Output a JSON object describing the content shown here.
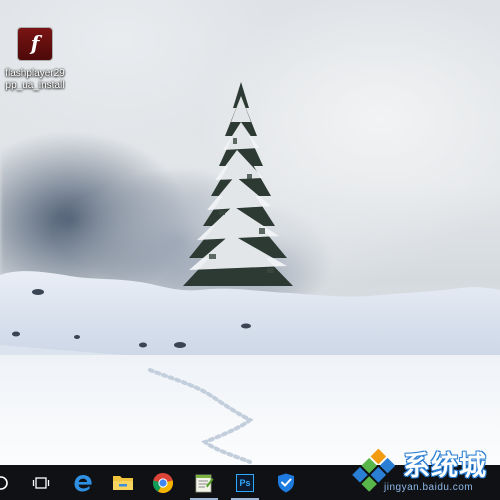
{
  "desktop": {
    "icons": [
      {
        "label": "flashplayer29pp_ua_install",
        "icon": "flash-player-icon",
        "glyph": "f"
      }
    ]
  },
  "taskbar": {
    "items": [
      {
        "name": "cortana-search-icon"
      },
      {
        "name": "task-view-icon"
      },
      {
        "name": "edge-browser-icon"
      },
      {
        "name": "file-explorer-icon"
      },
      {
        "name": "chrome-browser-icon"
      },
      {
        "name": "notepad-plus-icon"
      },
      {
        "name": "photoshop-icon",
        "text": "Ps"
      },
      {
        "name": "security-shield-icon"
      }
    ]
  },
  "watermark": {
    "brand": "系统城",
    "url": "jingyan.baidu.com"
  },
  "colors": {
    "taskbar": "#0f1114",
    "accent": "#2a7ed3"
  }
}
